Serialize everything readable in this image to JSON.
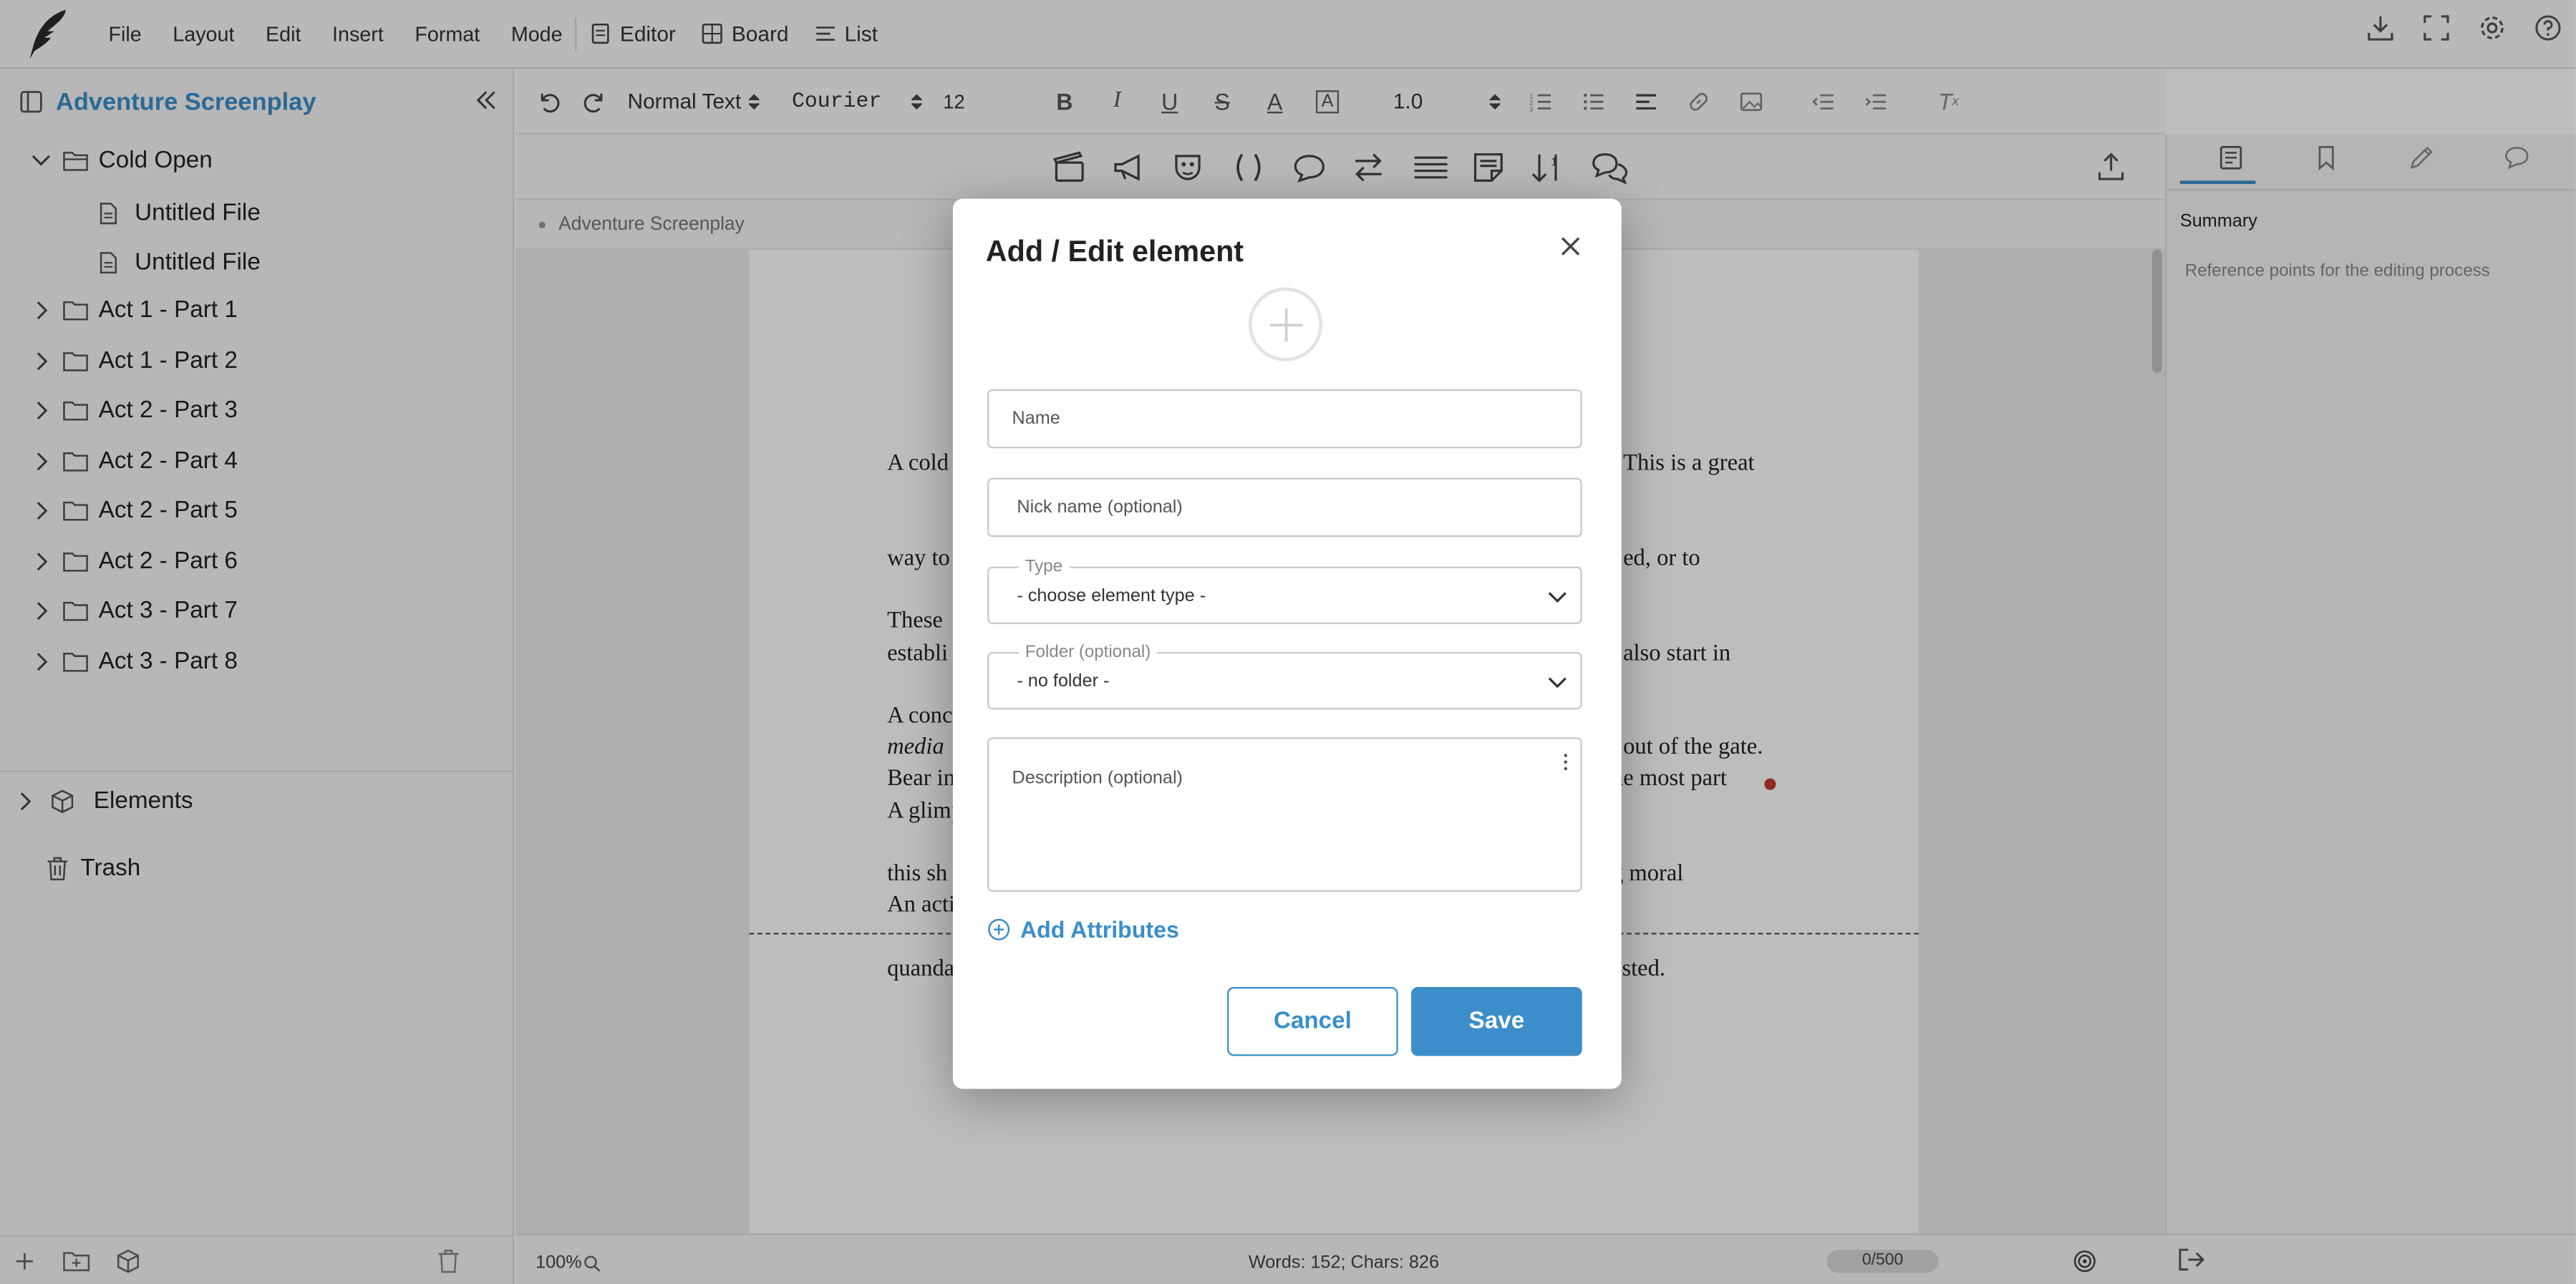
{
  "menubar": {
    "items": [
      "File",
      "Layout",
      "Edit",
      "Insert",
      "Format",
      "Mode"
    ],
    "modes": [
      "Editor",
      "Board",
      "List"
    ],
    "right_icons": [
      "download-icon",
      "fullscreen-icon",
      "settings-icon",
      "help-icon"
    ]
  },
  "sidebar": {
    "project_title": "Adventure Screenplay",
    "tree": [
      {
        "label": "Cold Open",
        "type": "folder",
        "expanded": true
      },
      {
        "label": "Untitled File",
        "type": "file"
      },
      {
        "label": "Untitled File",
        "type": "file"
      },
      {
        "label": "Act 1 - Part 1",
        "type": "folder"
      },
      {
        "label": "Act 1 - Part 2",
        "type": "folder"
      },
      {
        "label": "Act 2 - Part 3",
        "type": "folder"
      },
      {
        "label": "Act 2 - Part 4",
        "type": "folder"
      },
      {
        "label": "Act 2 - Part 5",
        "type": "folder"
      },
      {
        "label": "Act 2 - Part 6",
        "type": "folder"
      },
      {
        "label": "Act 3 - Part 7",
        "type": "folder"
      },
      {
        "label": "Act 3 - Part 8",
        "type": "folder"
      }
    ],
    "elements_label": "Elements",
    "trash_label": "Trash"
  },
  "toolbar": {
    "style_select": "Normal Text",
    "font_select": "Courier",
    "size_select": "12",
    "line_spacing": "1.0"
  },
  "breadcrumb": "Adventure Screenplay",
  "document": {
    "para1_left": [
      "A cold",
      "way to",
      "establi",
      "media"
    ],
    "para1_right": [
      "This is a great",
      "ed, or to",
      "also start in",
      "out of the gate."
    ],
    "para2_left": [
      "These",
      "A conc",
      "A glimp",
      "An acti"
    ],
    "para3_left": [
      "Bear in",
      "this sh",
      "quanda"
    ],
    "para3_right": [
      "ne most part",
      "g moral",
      "ested."
    ]
  },
  "statusbar": {
    "zoom": "100%",
    "counts": "Words: 152; Chars: 826",
    "goal": "0/500"
  },
  "right_panel": {
    "title": "Summary",
    "placeholder": "Reference points for the editing process"
  },
  "modal": {
    "title": "Add / Edit element",
    "name_placeholder": "Name",
    "nickname_placeholder": "Nick name (optional)",
    "type_legend": "Type",
    "type_value": "- choose element type -",
    "folder_legend": "Folder (optional)",
    "folder_value": "- no folder -",
    "description_placeholder": "Description (optional)",
    "add_attributes": "Add Attributes",
    "cancel": "Cancel",
    "save": "Save"
  },
  "colors": {
    "accent": "#3b8ec9",
    "overlay": "rgba(0,0,0,0.26)"
  }
}
